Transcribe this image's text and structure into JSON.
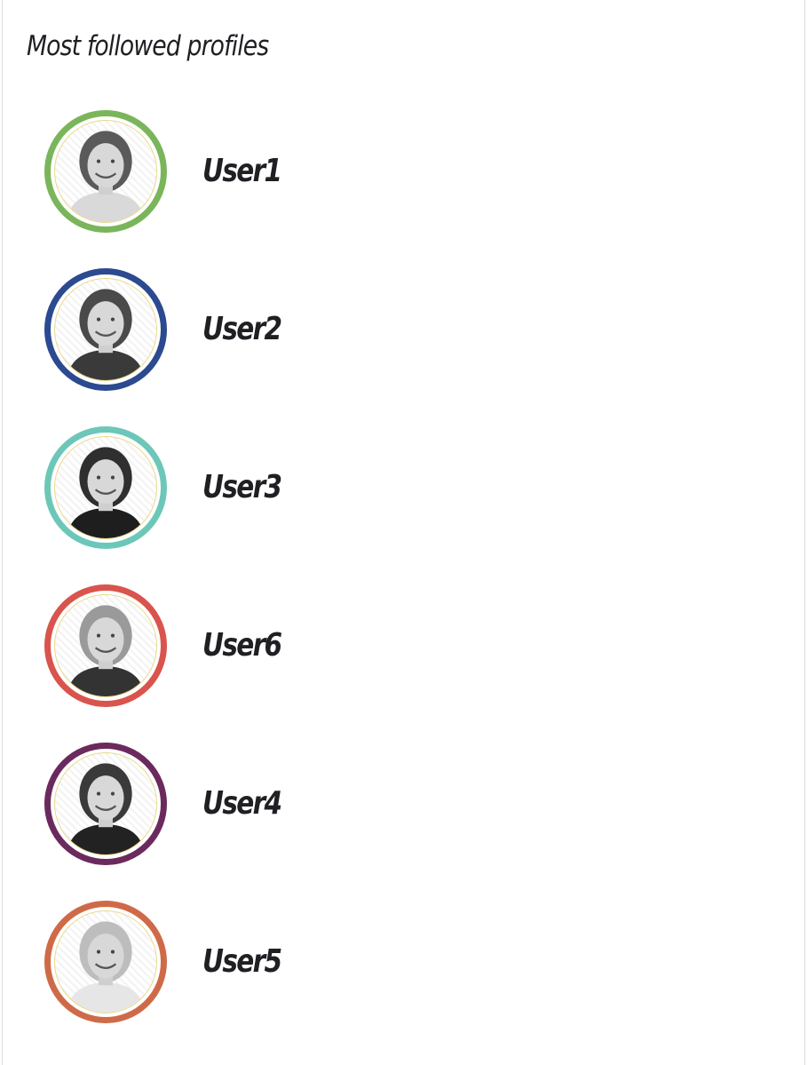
{
  "widget": {
    "title": "Most followed profiles"
  },
  "profiles": [
    {
      "name": "User1",
      "ring_color": "#7ab55c",
      "hair": "#5a5a5a",
      "shirt": "#d9d9d9"
    },
    {
      "name": "User2",
      "ring_color": "#2b4a8f",
      "hair": "#4a4a4a",
      "shirt": "#3a3a3a"
    },
    {
      "name": "User3",
      "ring_color": "#6cc7b8",
      "hair": "#2f2f2f",
      "shirt": "#1e1e1e"
    },
    {
      "name": "User6",
      "ring_color": "#d9544d",
      "hair": "#9a9a9a",
      "shirt": "#333333"
    },
    {
      "name": "User4",
      "ring_color": "#6b2a5e",
      "hair": "#3a3a3a",
      "shirt": "#222222"
    },
    {
      "name": "User5",
      "ring_color": "#cf6a49",
      "hair": "#bdbdbd",
      "shirt": "#e6e6e6"
    }
  ]
}
